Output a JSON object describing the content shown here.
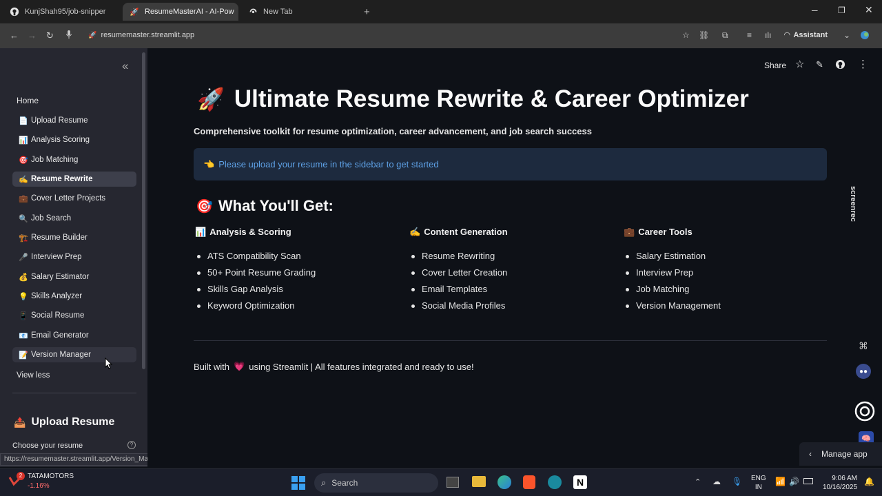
{
  "browser": {
    "tabs": [
      {
        "label": "KunjShah95/job-snipper",
        "icon": "github-icon"
      },
      {
        "label": "ResumeMasterAI - AI-Powere",
        "icon": "rocket-icon"
      },
      {
        "label": "New Tab",
        "icon": "newtab-icon"
      }
    ],
    "url": "resumemaster.streamlit.app",
    "assistant_label": "Assistant",
    "status_url": "https://resumemaster.streamlit.app/Version_Manager"
  },
  "sidebar": {
    "home": "Home",
    "items": [
      {
        "emoji": "📄",
        "label": "Upload Resume"
      },
      {
        "emoji": "📊",
        "label": "Analysis Scoring"
      },
      {
        "emoji": "🎯",
        "label": "Job Matching"
      },
      {
        "emoji": "✍️",
        "label": "Resume Rewrite"
      },
      {
        "emoji": "💼",
        "label": "Cover Letter Projects"
      },
      {
        "emoji": "🔍",
        "label": "Job Search"
      },
      {
        "emoji": "🏗️",
        "label": "Resume Builder"
      },
      {
        "emoji": "🎤",
        "label": "Interview Prep"
      },
      {
        "emoji": "💰",
        "label": "Salary Estimator"
      },
      {
        "emoji": "💡",
        "label": "Skills Analyzer"
      },
      {
        "emoji": "📱",
        "label": "Social Resume"
      },
      {
        "emoji": "📧",
        "label": "Email Generator"
      },
      {
        "emoji": "📝",
        "label": "Version Manager"
      }
    ],
    "active_index": 3,
    "view_less": "View less",
    "upload_heading": "Upload Resume",
    "upload_emoji": "📤",
    "choose_label": "Choose your resume"
  },
  "header": {
    "share": "Share"
  },
  "main": {
    "title_emoji": "🚀",
    "title": "Ultimate Resume Rewrite & Career Optimizer",
    "subtitle": "Comprehensive toolkit for resume optimization, career advancement, and job search success",
    "info_emoji": "👈",
    "info_text": "Please upload your resume in the sidebar to get started",
    "section_emoji": "🎯",
    "section_title": "What You'll Get:",
    "columns": [
      {
        "emoji": "📊",
        "title": "Analysis & Scoring",
        "items": [
          "ATS Compatibility Scan",
          "50+ Point Resume Grading",
          "Skills Gap Analysis",
          "Keyword Optimization"
        ]
      },
      {
        "emoji": "✍️",
        "title": "Content Generation",
        "items": [
          "Resume Rewriting",
          "Cover Letter Creation",
          "Email Templates",
          "Social Media Profiles"
        ]
      },
      {
        "emoji": "💼",
        "title": "Career Tools",
        "items": [
          "Salary Estimation",
          "Interview Prep",
          "Job Matching",
          "Version Management"
        ]
      }
    ],
    "footer_pre": "Built with",
    "footer_heart": "💗",
    "footer_post": "using Streamlit | All features integrated and ready to use!",
    "manage_app": "Manage app",
    "screenrec": "screenrec"
  },
  "taskbar": {
    "stock_name": "TATAMOTORS",
    "stock_change": "-1.16%",
    "stock_badge": "2",
    "search": "Search",
    "lang1": "ENG",
    "lang2": "IN",
    "time": "9:06 AM",
    "date": "10/16/2025"
  },
  "colors": {
    "accent_blue": "#5ea1e6",
    "negative": "#ff6b6b",
    "sidebar_bg": "#262730",
    "main_bg": "#0e1117"
  }
}
